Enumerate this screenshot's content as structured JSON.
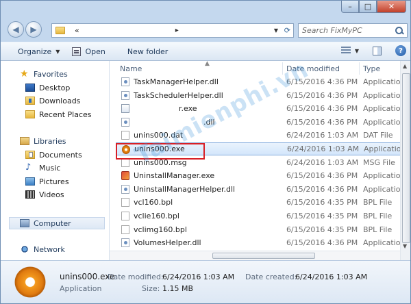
{
  "window": {
    "address": "«",
    "search_placeholder": "Search FixMyPC",
    "minimize_glyph": "–",
    "maximize_glyph": "□",
    "close_glyph": "✕"
  },
  "toolbar": {
    "organize": "Organize",
    "open": "Open",
    "new_folder": "New folder"
  },
  "nav": {
    "favorites": "Favorites",
    "desktop": "Desktop",
    "downloads": "Downloads",
    "recent_places": "Recent Places",
    "libraries": "Libraries",
    "documents": "Documents",
    "music": "Music",
    "pictures": "Pictures",
    "videos": "Videos",
    "computer": "Computer",
    "network": "Network"
  },
  "columns": {
    "name": "Name",
    "date_modified": "Date modified",
    "type": "Type"
  },
  "files": [
    {
      "name": "TaskManagerHelper.dll",
      "date": "6/15/2016 4:36 PM",
      "type": "Applicatio",
      "icon": "dll"
    },
    {
      "name": "TaskSchedulerHelper.dll",
      "date": "6/15/2016 4:36 PM",
      "type": "Applicatio",
      "icon": "dll"
    },
    {
      "name": "r.exe",
      "date": "6/15/2016 4:36 PM",
      "type": "Applicatio",
      "icon": "exe"
    },
    {
      "name": ".dll",
      "date": "6/15/2016 4:36 PM",
      "type": "Applicatio",
      "icon": "dll"
    },
    {
      "name": "unins000.dat",
      "date": "6/24/2016 1:03 AM",
      "type": "DAT File",
      "icon": "dat"
    },
    {
      "name": "unins000.exe",
      "date": "6/24/2016 1:03 AM",
      "type": "Applicatio",
      "icon": "setup"
    },
    {
      "name": "unins000.msg",
      "date": "6/24/2016 1:03 AM",
      "type": "MSG File",
      "icon": "dat"
    },
    {
      "name": "UninstallManager.exe",
      "date": "6/15/2016 4:36 PM",
      "type": "Applicatio",
      "icon": "uninst"
    },
    {
      "name": "UninstallManagerHelper.dll",
      "date": "6/15/2016 4:36 PM",
      "type": "Applicatio",
      "icon": "dll"
    },
    {
      "name": "vcl160.bpl",
      "date": "6/15/2016 4:35 PM",
      "type": "BPL File",
      "icon": "bpl"
    },
    {
      "name": "vclie160.bpl",
      "date": "6/15/2016 4:35 PM",
      "type": "BPL File",
      "icon": "bpl"
    },
    {
      "name": "vclimg160.bpl",
      "date": "6/15/2016 4:35 PM",
      "type": "BPL File",
      "icon": "bpl"
    },
    {
      "name": "VolumesHelper.dll",
      "date": "6/15/2016 4:36 PM",
      "type": "Applicatio",
      "icon": "dll"
    }
  ],
  "details": {
    "filename": "unins000.exe",
    "filetype": "Application",
    "date_modified_label": "Date modified:",
    "date_modified_value": "6/24/2016 1:03 AM",
    "date_created_label": "Date created:",
    "date_created_value": "6/24/2016 1:03 AM",
    "size_label": "Size:",
    "size_value": "1.15 MB"
  },
  "watermark": "Taimienphi.vn",
  "colors": {
    "selection": "#d3e6fb",
    "highlight_box": "#d81f26",
    "accent": "#1e395b"
  }
}
